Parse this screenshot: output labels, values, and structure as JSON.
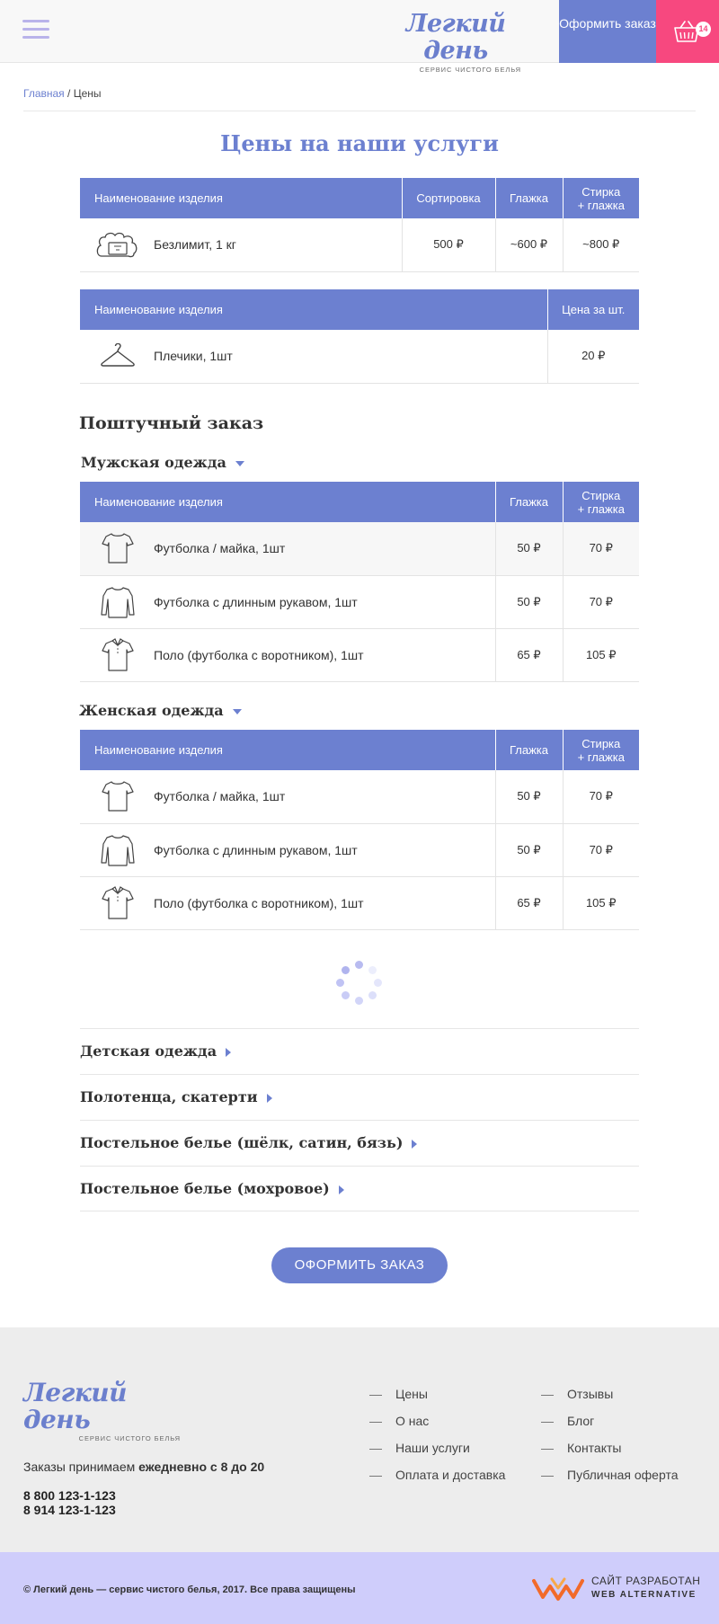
{
  "header": {
    "logo_title": "Легкий день",
    "logo_subtitle": "СЕРВИС ЧИСТОГО БЕЛЬЯ",
    "order_button": "Оформить заказ",
    "cart_count": "14",
    "colors": {
      "accent": "#6c80d0",
      "cart": "#f7487f"
    }
  },
  "breadcrumb": {
    "home": "Главная",
    "separator": " / ",
    "current": "Цены"
  },
  "page_title": "Цены на наши услуги",
  "table1": {
    "headers": [
      "Наименование изделия",
      "Сортировка",
      "Глажка",
      "Стирка\n+ глажка"
    ],
    "rows": [
      {
        "icon": "laundry-bag-icon",
        "name": "Безлимит, 1 кг",
        "sort": "500 ₽",
        "iron": "~600 ₽",
        "wash": "~800 ₽"
      }
    ]
  },
  "table2": {
    "headers": [
      "Наименование изделия",
      "Цена за шт."
    ],
    "rows": [
      {
        "icon": "hanger-icon",
        "name": "Плечики, 1шт",
        "price": "20 ₽"
      }
    ]
  },
  "piece_order_title": "Поштучный заказ",
  "men": {
    "title": "Мужская одежда",
    "headers": [
      "Наименование изделия",
      "Глажка",
      "Стирка\n+ глажка"
    ],
    "rows": [
      {
        "icon": "tshirt-icon",
        "name": "Футболка / майка, 1шт",
        "iron": "50 ₽",
        "wash": "70 ₽"
      },
      {
        "icon": "longsleeve-icon",
        "name": "Футболка с длинным рукавом, 1шт",
        "iron": "50 ₽",
        "wash": "70 ₽"
      },
      {
        "icon": "polo-icon",
        "name": "Поло (футболка с воротником), 1шт",
        "iron": "65 ₽",
        "wash": "105 ₽"
      }
    ]
  },
  "women": {
    "title": "Женская одежда",
    "headers": [
      "Наименование изделия",
      "Глажка",
      "Стирка\n+ глажка"
    ],
    "rows": [
      {
        "icon": "tshirt-icon",
        "name": "Футболка / майка, 1шт",
        "iron": "50 ₽",
        "wash": "70 ₽"
      },
      {
        "icon": "longsleeve-icon",
        "name": "Футболка с длинным рукавом, 1шт",
        "iron": "50 ₽",
        "wash": "70 ₽"
      },
      {
        "icon": "polo-icon",
        "name": "Поло (футболка с воротником), 1шт",
        "iron": "65 ₽",
        "wash": "105 ₽"
      }
    ]
  },
  "collapsed_categories": [
    "Детская одежда",
    "Полотенца, скатерти",
    "Постельное белье (шёлк, сатин, бязь)",
    "Постельное белье (мохровое)"
  ],
  "submit_button": "ОФОРМИТЬ ЗАКАЗ",
  "footer": {
    "logo_title": "Легкий день",
    "logo_subtitle": "СЕРВИС ЧИСТОГО БЕЛЬЯ",
    "hours_prefix": "Заказы  принимаем ",
    "hours_bold": "ежедневно с 8 до 20",
    "phones": [
      "8 800 123-1-123",
      "8 914  123-1-123"
    ],
    "links_col1": [
      "Цены",
      "О нас",
      "Наши услуги",
      "Оплата и доставка"
    ],
    "links_col2": [
      "Отзывы",
      "Блог",
      "Контакты",
      "Публичная оферта"
    ]
  },
  "bottom_bar": {
    "copyright": "© Легкий день — сервис чистого белья, 2017. Все права защищены",
    "dev_line1": "САЙТ РАЗРАБОТАН",
    "dev_line2": "WEB ALTERNATIVE"
  }
}
